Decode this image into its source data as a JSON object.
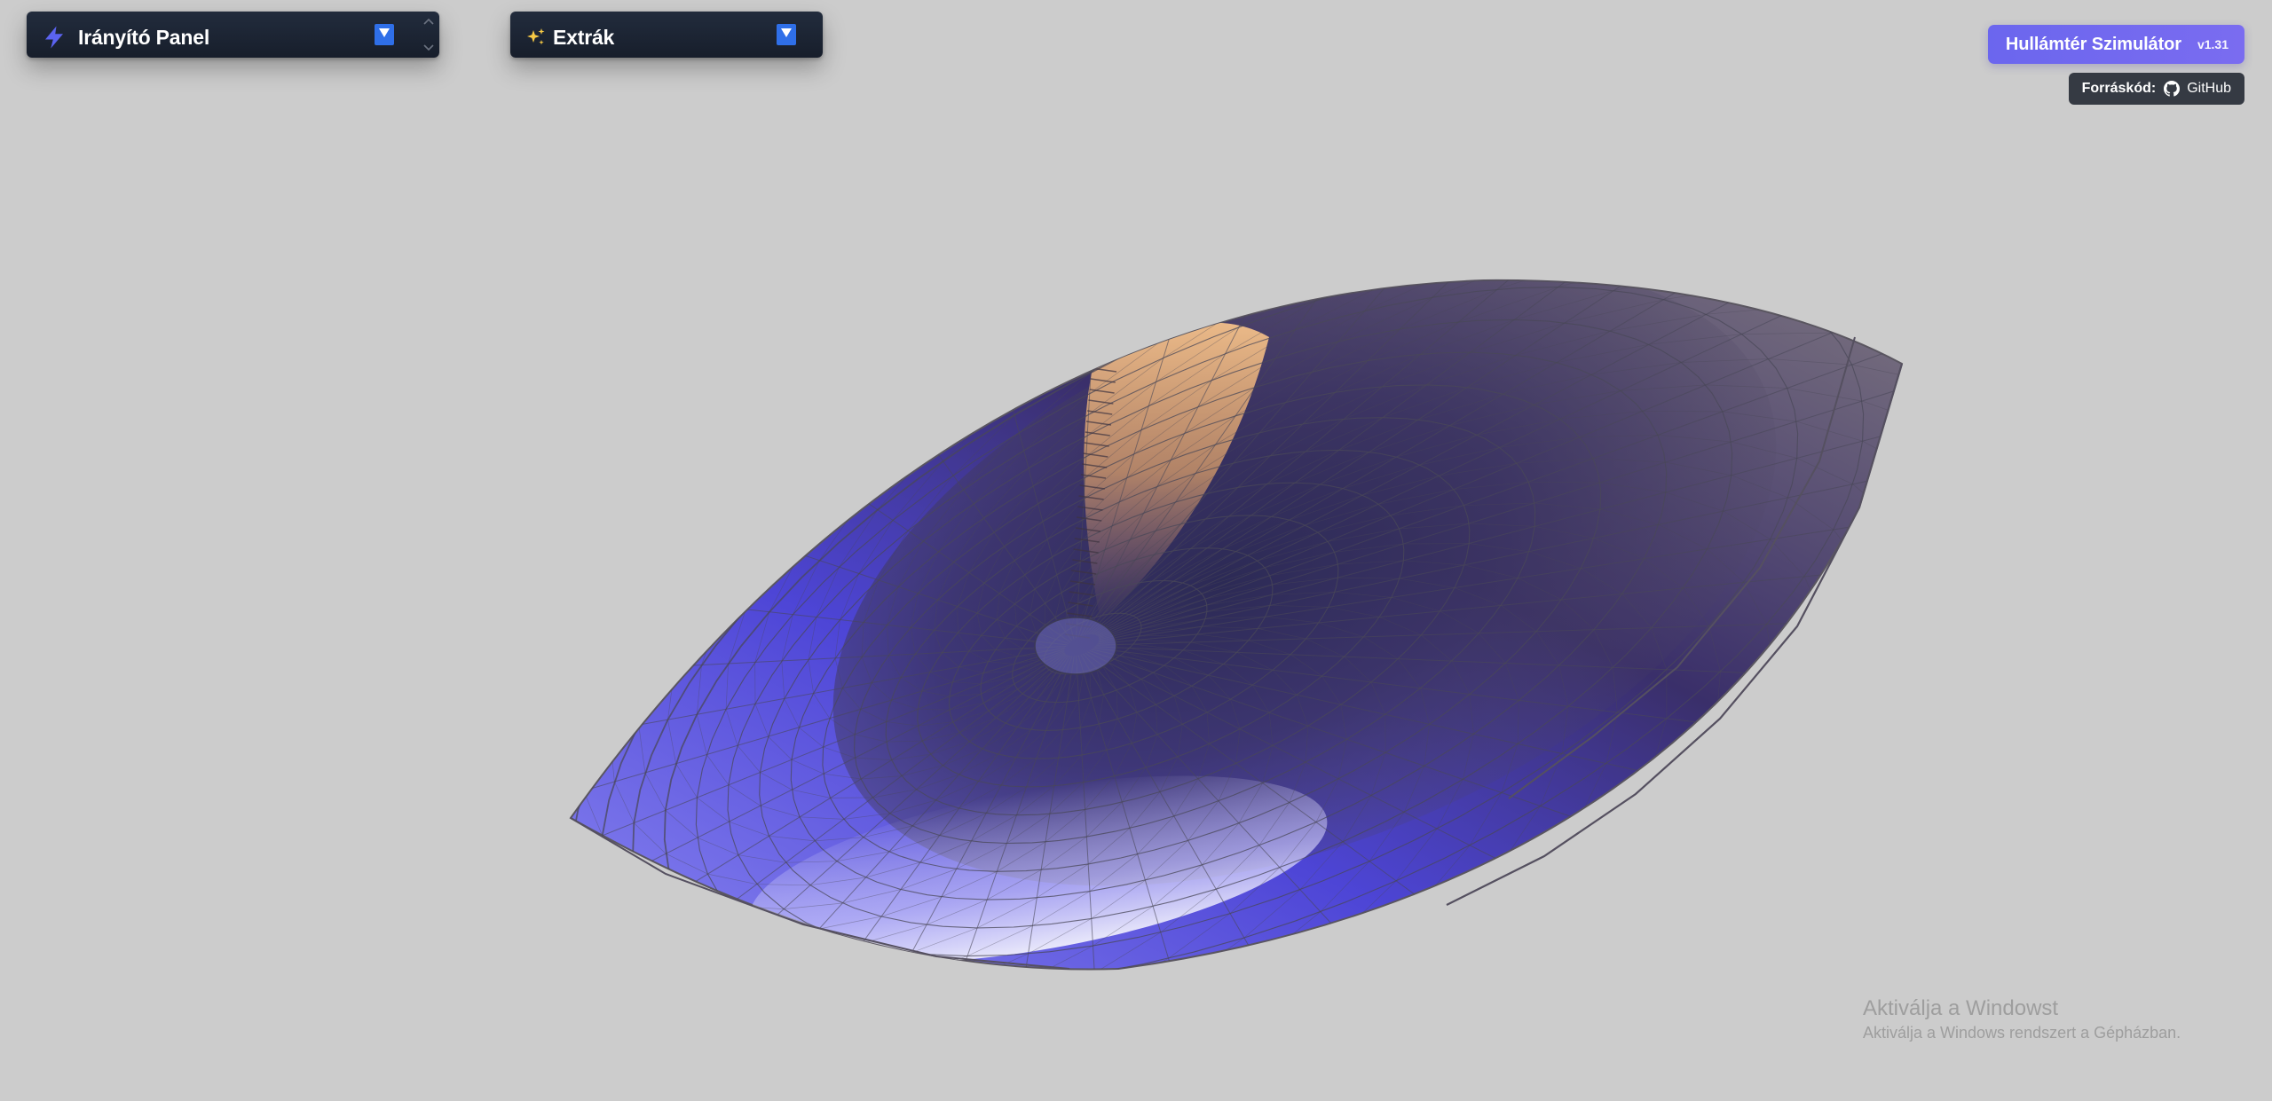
{
  "control_panel": {
    "title": "Irányító Panel",
    "icon": "lightning-bolt-icon"
  },
  "extras_panel": {
    "title": "Extrák",
    "icon": "sparkles-icon"
  },
  "app": {
    "name": "Hullámtér Szimulátor",
    "version": "v1.31"
  },
  "source": {
    "label": "Forráskód:",
    "link_text": "GitHub",
    "icon": "github-icon"
  },
  "watermark": {
    "title": "Aktiválja a Windowst",
    "subtitle": "Aktiválja a Windows rendszert a Gépházban."
  },
  "colors": {
    "background": "#cccccc",
    "panel": "#1b2331",
    "dropdown_button": "#2f6fe8",
    "title_badge": "#6f69ef",
    "source_badge": "#353a43",
    "surface_blue": "#5a55e8",
    "surface_dark": "#3a3340",
    "surface_highlight": "#e8a860",
    "wireframe": "#4a4a55"
  }
}
